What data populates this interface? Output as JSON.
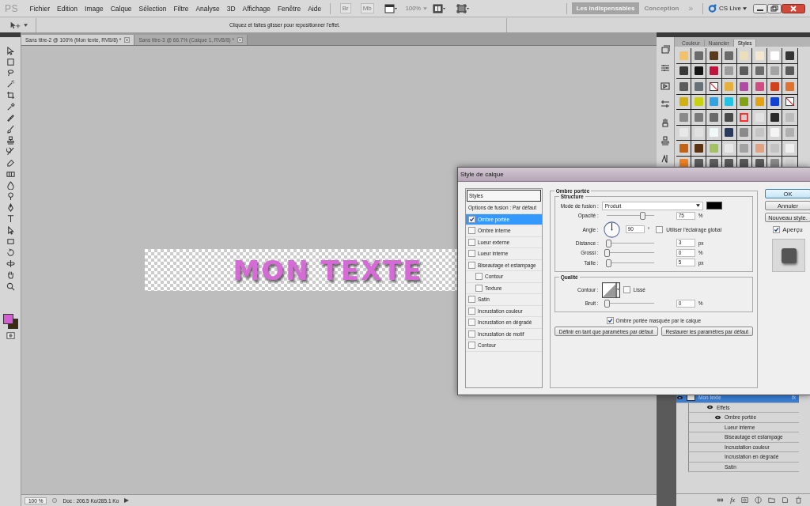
{
  "menu_bar": {
    "logo": "PS",
    "menus": [
      "Fichier",
      "Edition",
      "Image",
      "Calque",
      "Sélection",
      "Filtre",
      "Analyse",
      "3D",
      "Affichage",
      "Fenêtre",
      "Aide"
    ],
    "launchers": [
      "Br",
      "Mb"
    ],
    "zoom": "100%",
    "workspaces": [
      {
        "label": "Les indispensables",
        "selected": true
      },
      {
        "label": "Conception",
        "selected": false
      }
    ],
    "more": "»",
    "cs_live": "CS Live"
  },
  "options_bar": {
    "hint": "Cliquez et faites glisser pour repositionner l'effet."
  },
  "tabs": [
    {
      "label": "Sans titre-2 @ 100% (Mon texte, RVB/8) *",
      "selected": true
    },
    {
      "label": "Sans titre-3 @ 66.7% (Calque 1, RVB/8) *",
      "selected": false
    }
  ],
  "canvas": {
    "text": "MON TEXTE"
  },
  "status_bar": {
    "zoom": "100 %",
    "doc": "Doc : 206.5 Ko/285.1 Ko"
  },
  "styles_panel": {
    "tabs": [
      {
        "label": "Couleur",
        "selected": false
      },
      {
        "label": "Nuancier",
        "selected": false
      },
      {
        "label": "Styles",
        "selected": true
      }
    ],
    "swatch_rows": [
      [
        {
          "kind": "fill",
          "color": "#f2c26a"
        },
        {
          "kind": "fill",
          "color": "#6b6b6b"
        },
        {
          "kind": "fill",
          "color": "#5c3b1a"
        },
        {
          "kind": "fill",
          "color": "#6a6a6a"
        },
        {
          "kind": "fill",
          "color": "#ebdfb9"
        },
        {
          "kind": "fill",
          "color": "#f3e7cd"
        },
        {
          "kind": "fill",
          "color": "#ffffff"
        },
        {
          "kind": "fill",
          "color": "#333333"
        }
      ],
      [
        {
          "kind": "fill",
          "color": "#3a3a3a"
        },
        {
          "kind": "fill",
          "color": "#161616"
        },
        {
          "kind": "fill",
          "color": "#c3123c"
        },
        {
          "kind": "fill",
          "color": "#9c9c9c"
        },
        {
          "kind": "fill",
          "color": "#5c5c5c"
        },
        {
          "kind": "fill",
          "color": "#6c6c6c"
        },
        {
          "kind": "fill",
          "color": "#a4a4a4"
        },
        {
          "kind": "fill",
          "color": "#5a5a5a"
        }
      ],
      [
        {
          "kind": "fill",
          "color": "#5b5b5b"
        },
        {
          "kind": "fill",
          "color": "#687078"
        },
        {
          "kind": "none",
          "color": "#ffffff"
        },
        {
          "kind": "fill",
          "color": "#e6b03e"
        },
        {
          "kind": "fill",
          "color": "#b04aa2"
        },
        {
          "kind": "fill",
          "color": "#d24b82"
        },
        {
          "kind": "fill",
          "color": "#d2421e"
        },
        {
          "kind": "fill",
          "color": "#e0722e"
        }
      ],
      [
        {
          "kind": "fill",
          "color": "#d2b012"
        },
        {
          "kind": "fill",
          "color": "#c8d012"
        },
        {
          "kind": "fill",
          "color": "#32a2e2"
        },
        {
          "kind": "fill",
          "color": "#22c2e2"
        },
        {
          "kind": "fill",
          "color": "#82a212"
        },
        {
          "kind": "fill",
          "color": "#e2a212"
        },
        {
          "kind": "fill",
          "color": "#1242d2"
        },
        {
          "kind": "none",
          "color": "#ffffff"
        }
      ],
      [
        {
          "kind": "fill",
          "color": "#8a8a8a"
        },
        {
          "kind": "fill",
          "color": "#7a7a7a"
        },
        {
          "kind": "fill",
          "color": "#6a6a6a"
        },
        {
          "kind": "fill",
          "color": "#4a4a4a"
        },
        {
          "kind": "outline",
          "color": "#ff3030"
        },
        {
          "kind": "fill",
          "color": "#e2e2e2"
        },
        {
          "kind": "fill",
          "color": "#2a2a2a"
        },
        {
          "kind": "fill",
          "color": "#bcbcbc"
        }
      ],
      [
        {
          "kind": "fill",
          "color": "#e8e8e8"
        },
        {
          "kind": "fill",
          "color": "#e0e0e0"
        },
        {
          "kind": "fill",
          "color": "#f0f8f8"
        },
        {
          "kind": "fill",
          "color": "#2a3a5a"
        },
        {
          "kind": "fill",
          "color": "#8a8a8a"
        },
        {
          "kind": "fill",
          "color": "#c4c4c4"
        },
        {
          "kind": "fill",
          "color": "#f4f4f4"
        },
        {
          "kind": "fill",
          "color": "#b0b0b0"
        }
      ],
      [
        {
          "kind": "fill",
          "color": "#c26212"
        },
        {
          "kind": "fill",
          "color": "#5c3212"
        },
        {
          "kind": "fill",
          "color": "#a2c262"
        },
        {
          "kind": "fill",
          "color": "#e8e8e8"
        },
        {
          "kind": "fill",
          "color": "#a2a2a2"
        },
        {
          "kind": "fill",
          "color": "#e2a282"
        },
        {
          "kind": "fill",
          "color": "#c2c2c2"
        },
        {
          "kind": "fill",
          "color": "#f0f0f0"
        }
      ],
      [
        {
          "kind": "fill",
          "color": "#f08222"
        },
        {
          "kind": "fill",
          "color": "#5c5c5c"
        },
        {
          "kind": "fill",
          "color": "#5e5e5e"
        },
        {
          "kind": "fill",
          "color": "#5a5a5a"
        },
        {
          "kind": "fill",
          "color": "#585858"
        },
        {
          "kind": "fill",
          "color": "#5b5b5b"
        },
        {
          "kind": "fill",
          "color": "#8a8a8a"
        },
        {
          "kind": "fill",
          "color": "#d0d0d0"
        }
      ]
    ]
  },
  "layers_panel": {
    "fx_button": "fx",
    "layers": [
      {
        "name": "Mon texte",
        "selected": true,
        "fx": "fx",
        "children": [
          {
            "name": "Effets",
            "visible": true,
            "children": [
              {
                "name": "Ombre portée",
                "visible": true
              },
              {
                "name": "Lueur interne",
                "visible": false
              },
              {
                "name": "Biseautage et estampage",
                "visible": false
              },
              {
                "name": "Incrustation couleur",
                "visible": false
              },
              {
                "name": "Incrustation en dégradé",
                "visible": false
              },
              {
                "name": "Satin",
                "visible": false
              }
            ]
          }
        ]
      }
    ]
  },
  "dialog": {
    "title": "Style de calque",
    "styles_list": [
      {
        "label": "Styles",
        "kind": "header",
        "selected": false
      },
      {
        "label": "Options de fusion : Par défaut",
        "kind": "option",
        "selected": false
      },
      {
        "label": "Ombre portée",
        "kind": "check",
        "checked": true,
        "selected": true
      },
      {
        "label": "Ombre interne",
        "kind": "check",
        "checked": false,
        "selected": false
      },
      {
        "label": "Lueur externe",
        "kind": "check",
        "checked": false,
        "selected": false
      },
      {
        "label": "Lueur interne",
        "kind": "check",
        "checked": false,
        "selected": false
      },
      {
        "label": "Biseautage et estampage",
        "kind": "check",
        "checked": false,
        "selected": false,
        "children": [
          {
            "label": "Contour",
            "checked": false,
            "selected": false
          },
          {
            "label": "Texture",
            "checked": false,
            "selected": false
          }
        ]
      },
      {
        "label": "Satin",
        "kind": "check",
        "checked": false,
        "selected": false
      },
      {
        "label": "Incrustation couleur",
        "kind": "check",
        "checked": false,
        "selected": false
      },
      {
        "label": "Incrustation en dégradé",
        "kind": "check",
        "checked": false,
        "selected": false
      },
      {
        "label": "Incrustation de motif",
        "kind": "check",
        "checked": false,
        "selected": false
      },
      {
        "label": "Contour",
        "kind": "check",
        "checked": false,
        "selected": false
      }
    ],
    "section_title": "Ombre portée",
    "structure": {
      "title": "Structure",
      "blend_label": "Mode de fusion :",
      "blend_value": "Produit",
      "color": "#000000",
      "rows": [
        {
          "kind": "slider",
          "label": "Opacité :",
          "level": 0.75,
          "value": "75",
          "unit": "%"
        },
        {
          "kind": "angle",
          "label": "Angle :",
          "value": "90",
          "unit": "°",
          "checkbox": {
            "label": "Utiliser l'éclairage global",
            "checked": false
          }
        },
        {
          "kind": "slider",
          "label": "Distance :",
          "level": 0.03,
          "value": "3",
          "unit": "px"
        },
        {
          "kind": "slider",
          "label": "Grossi :",
          "level": 0,
          "value": "0",
          "unit": "%"
        },
        {
          "kind": "slider",
          "label": "Taille :",
          "level": 0.03,
          "value": "5",
          "unit": "px"
        }
      ]
    },
    "quality": {
      "title": "Qualité",
      "contour_label": "Contour :",
      "smooth": {
        "label": "Lissé",
        "checked": false
      },
      "noise": {
        "label": "Bruit :",
        "level": 0,
        "value": "0",
        "unit": "%"
      }
    },
    "knockout": {
      "label": "Ombre portée masquée par le calque",
      "checked": true
    },
    "default_buttons": [
      "Définir en tant que paramètres par défaut",
      "Restaurer les paramètres par défaut"
    ],
    "buttons": [
      "OK",
      "Annuler",
      "Nouveau style."
    ],
    "preview": {
      "label": "Aperçu",
      "checked": true
    }
  }
}
